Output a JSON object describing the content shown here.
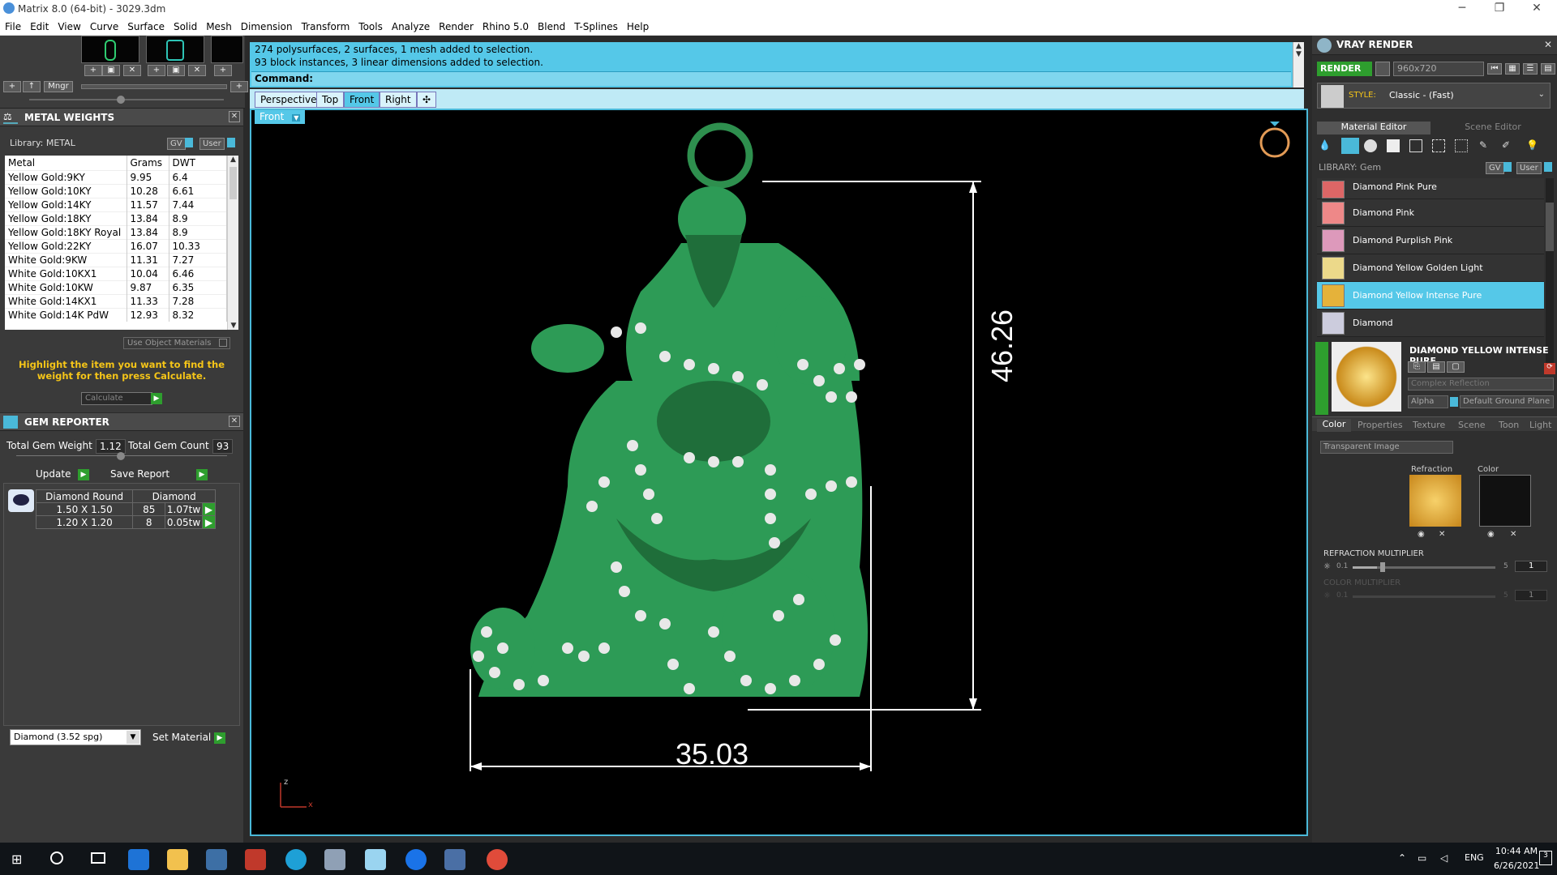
{
  "window": {
    "title": "Matrix 8.0 (64-bit) - 3029.3dm",
    "min": "─",
    "max": "❐",
    "close": "✕"
  },
  "menu": [
    "File",
    "Edit",
    "View",
    "Curve",
    "Surface",
    "Solid",
    "Mesh",
    "Dimension",
    "Transform",
    "Tools",
    "Analyze",
    "Render",
    "Rhino 5.0",
    "Blend",
    "T-Splines",
    "Help"
  ],
  "lefttop": {
    "mngr": "Mngr"
  },
  "metal": {
    "title": "METAL WEIGHTS",
    "library": "Library: METAL",
    "gv": "GV",
    "user": "User",
    "columns": [
      "Metal",
      "Grams",
      "DWT"
    ],
    "rows": [
      [
        "Yellow Gold:9KY",
        "9.95",
        "6.4"
      ],
      [
        "Yellow Gold:10KY",
        "10.28",
        "6.61"
      ],
      [
        "Yellow Gold:14KY",
        "11.57",
        "7.44"
      ],
      [
        "Yellow Gold:18KY",
        "13.84",
        "8.9"
      ],
      [
        "Yellow Gold:18KY Royal",
        "13.84",
        "8.9"
      ],
      [
        "Yellow Gold:22KY",
        "16.07",
        "10.33"
      ],
      [
        "White Gold:9KW",
        "11.31",
        "7.27"
      ],
      [
        "White Gold:10KX1",
        "10.04",
        "6.46"
      ],
      [
        "White Gold:10KW",
        "9.87",
        "6.35"
      ],
      [
        "White Gold:14KX1",
        "11.33",
        "7.28"
      ],
      [
        "White Gold:14K PdW",
        "12.93",
        "8.32"
      ]
    ],
    "use_object": "Use Object Materials",
    "hint": "Highlight the item you want to find the weight for then press Calculate.",
    "calculate": "Calculate"
  },
  "gem": {
    "title": "GEM REPORTER",
    "weight_label": "Total Gem Weight",
    "weight": "1.12",
    "count_label": "Total Gem Count",
    "count": "93",
    "update": "Update",
    "save": "Save Report",
    "headers": [
      "Diamond Round",
      "Diamond"
    ],
    "rows": [
      [
        "1.50 X 1.50",
        "85",
        "1.07tw"
      ],
      [
        "1.20 X 1.20",
        "8",
        "0.05tw"
      ]
    ],
    "material": "Diamond    (3.52 spg)",
    "set_material": "Set Material"
  },
  "command": {
    "line1": "274 polysurfaces, 2 surfaces, 1 mesh added to selection.",
    "line2": "93 block instances, 3 linear dimensions added to selection.",
    "prompt": "Command:"
  },
  "tabs": [
    "Perspective",
    "Top",
    "Front",
    "Right",
    "✣"
  ],
  "viewport": {
    "label": "Front",
    "dim_height": "46.26",
    "dim_width": "35.03",
    "axis_z": "z",
    "axis_x": "x"
  },
  "vray": {
    "title": "VRAY RENDER",
    "render": "RENDER",
    "resolution": "960x720",
    "style_label": "STYLE:",
    "style": "Classic - (Fast)",
    "tab_material": "Material Editor",
    "tab_scene": "Scene Editor",
    "library": "LIBRARY: Gem",
    "items": [
      "Diamond Pink Pure",
      "Diamond Pink",
      "Diamond Purplish Pink",
      "Diamond Yellow Golden Light",
      "Diamond Yellow Intense Pure",
      "Diamond"
    ],
    "selected_title": "DIAMOND YELLOW INTENSE PURE",
    "complex": "Complex Reflection",
    "alpha": "Alpha",
    "ground": "Default Ground Plane",
    "subtabs": [
      "Color",
      "Properties",
      "Texture",
      "Scene",
      "Toon",
      "Light"
    ],
    "transparent": "Transparent Image",
    "refraction": "Refraction",
    "color": "Color",
    "refr_mult": "REFRACTION MULTIPLIER",
    "color_mult": "COLOR MULTIPLIER",
    "min": "0.1",
    "max": "5",
    "val": "1"
  },
  "taskbar": {
    "lang": "ENG",
    "time": "10:44 AM",
    "date": "6/26/2021",
    "notif": "3"
  }
}
